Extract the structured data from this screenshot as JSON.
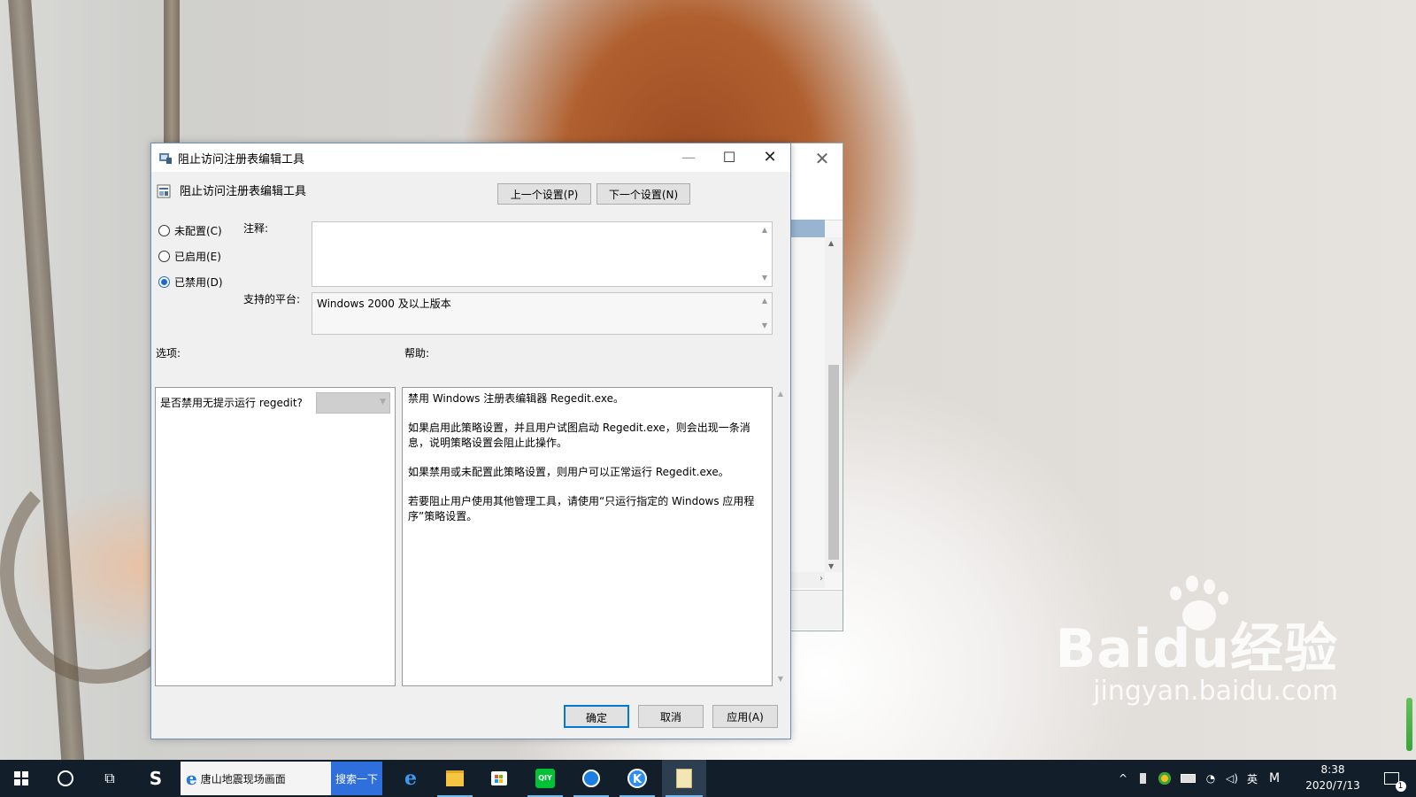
{
  "dialog": {
    "window_title": "阻止访问注册表编辑工具",
    "header_title": "阻止访问注册表编辑工具",
    "prev_button": "上一个设置(P)",
    "next_button": "下一个设置(N)",
    "radio": {
      "not_configured": "未配置(C)",
      "enabled": "已启用(E)",
      "disabled": "已禁用(D)",
      "selected": "disabled"
    },
    "comment_label": "注释:",
    "comment_value": "",
    "platform_label": "支持的平台:",
    "platform_value": "Windows 2000 及以上版本",
    "options_label": "选项:",
    "help_label": "帮助:",
    "option_question": "是否禁用无提示运行 regedit?",
    "help_paragraphs": [
      "禁用 Windows 注册表编辑器 Regedit.exe。",
      "如果启用此策略设置，并且用户试图启动 Regedit.exe，则会出现一条消息，说明策略设置会阻止此操作。",
      "如果禁用或未配置此策略设置，则用户可以正常运行 Regedit.exe。",
      "若要阻止用户使用其他管理工具，请使用“只运行指定的 Windows 应用程序”策略设置。"
    ],
    "ok_button": "确定",
    "cancel_button": "取消",
    "apply_button": "应用(A)"
  },
  "taskbar": {
    "search_text": "唐山地震现场画面",
    "search_button": "搜索一下",
    "ime_label": "英",
    "ime_mode": "M",
    "time": "8:38",
    "date": "2020/7/13",
    "notification_count": "1"
  },
  "watermark": {
    "logo_text": "Baidu经验",
    "url_text": "jingyan.baidu.com"
  },
  "colors": {
    "accent": "#0078d7",
    "taskbar": "#121e2a",
    "search_button": "#2f6fdc"
  }
}
